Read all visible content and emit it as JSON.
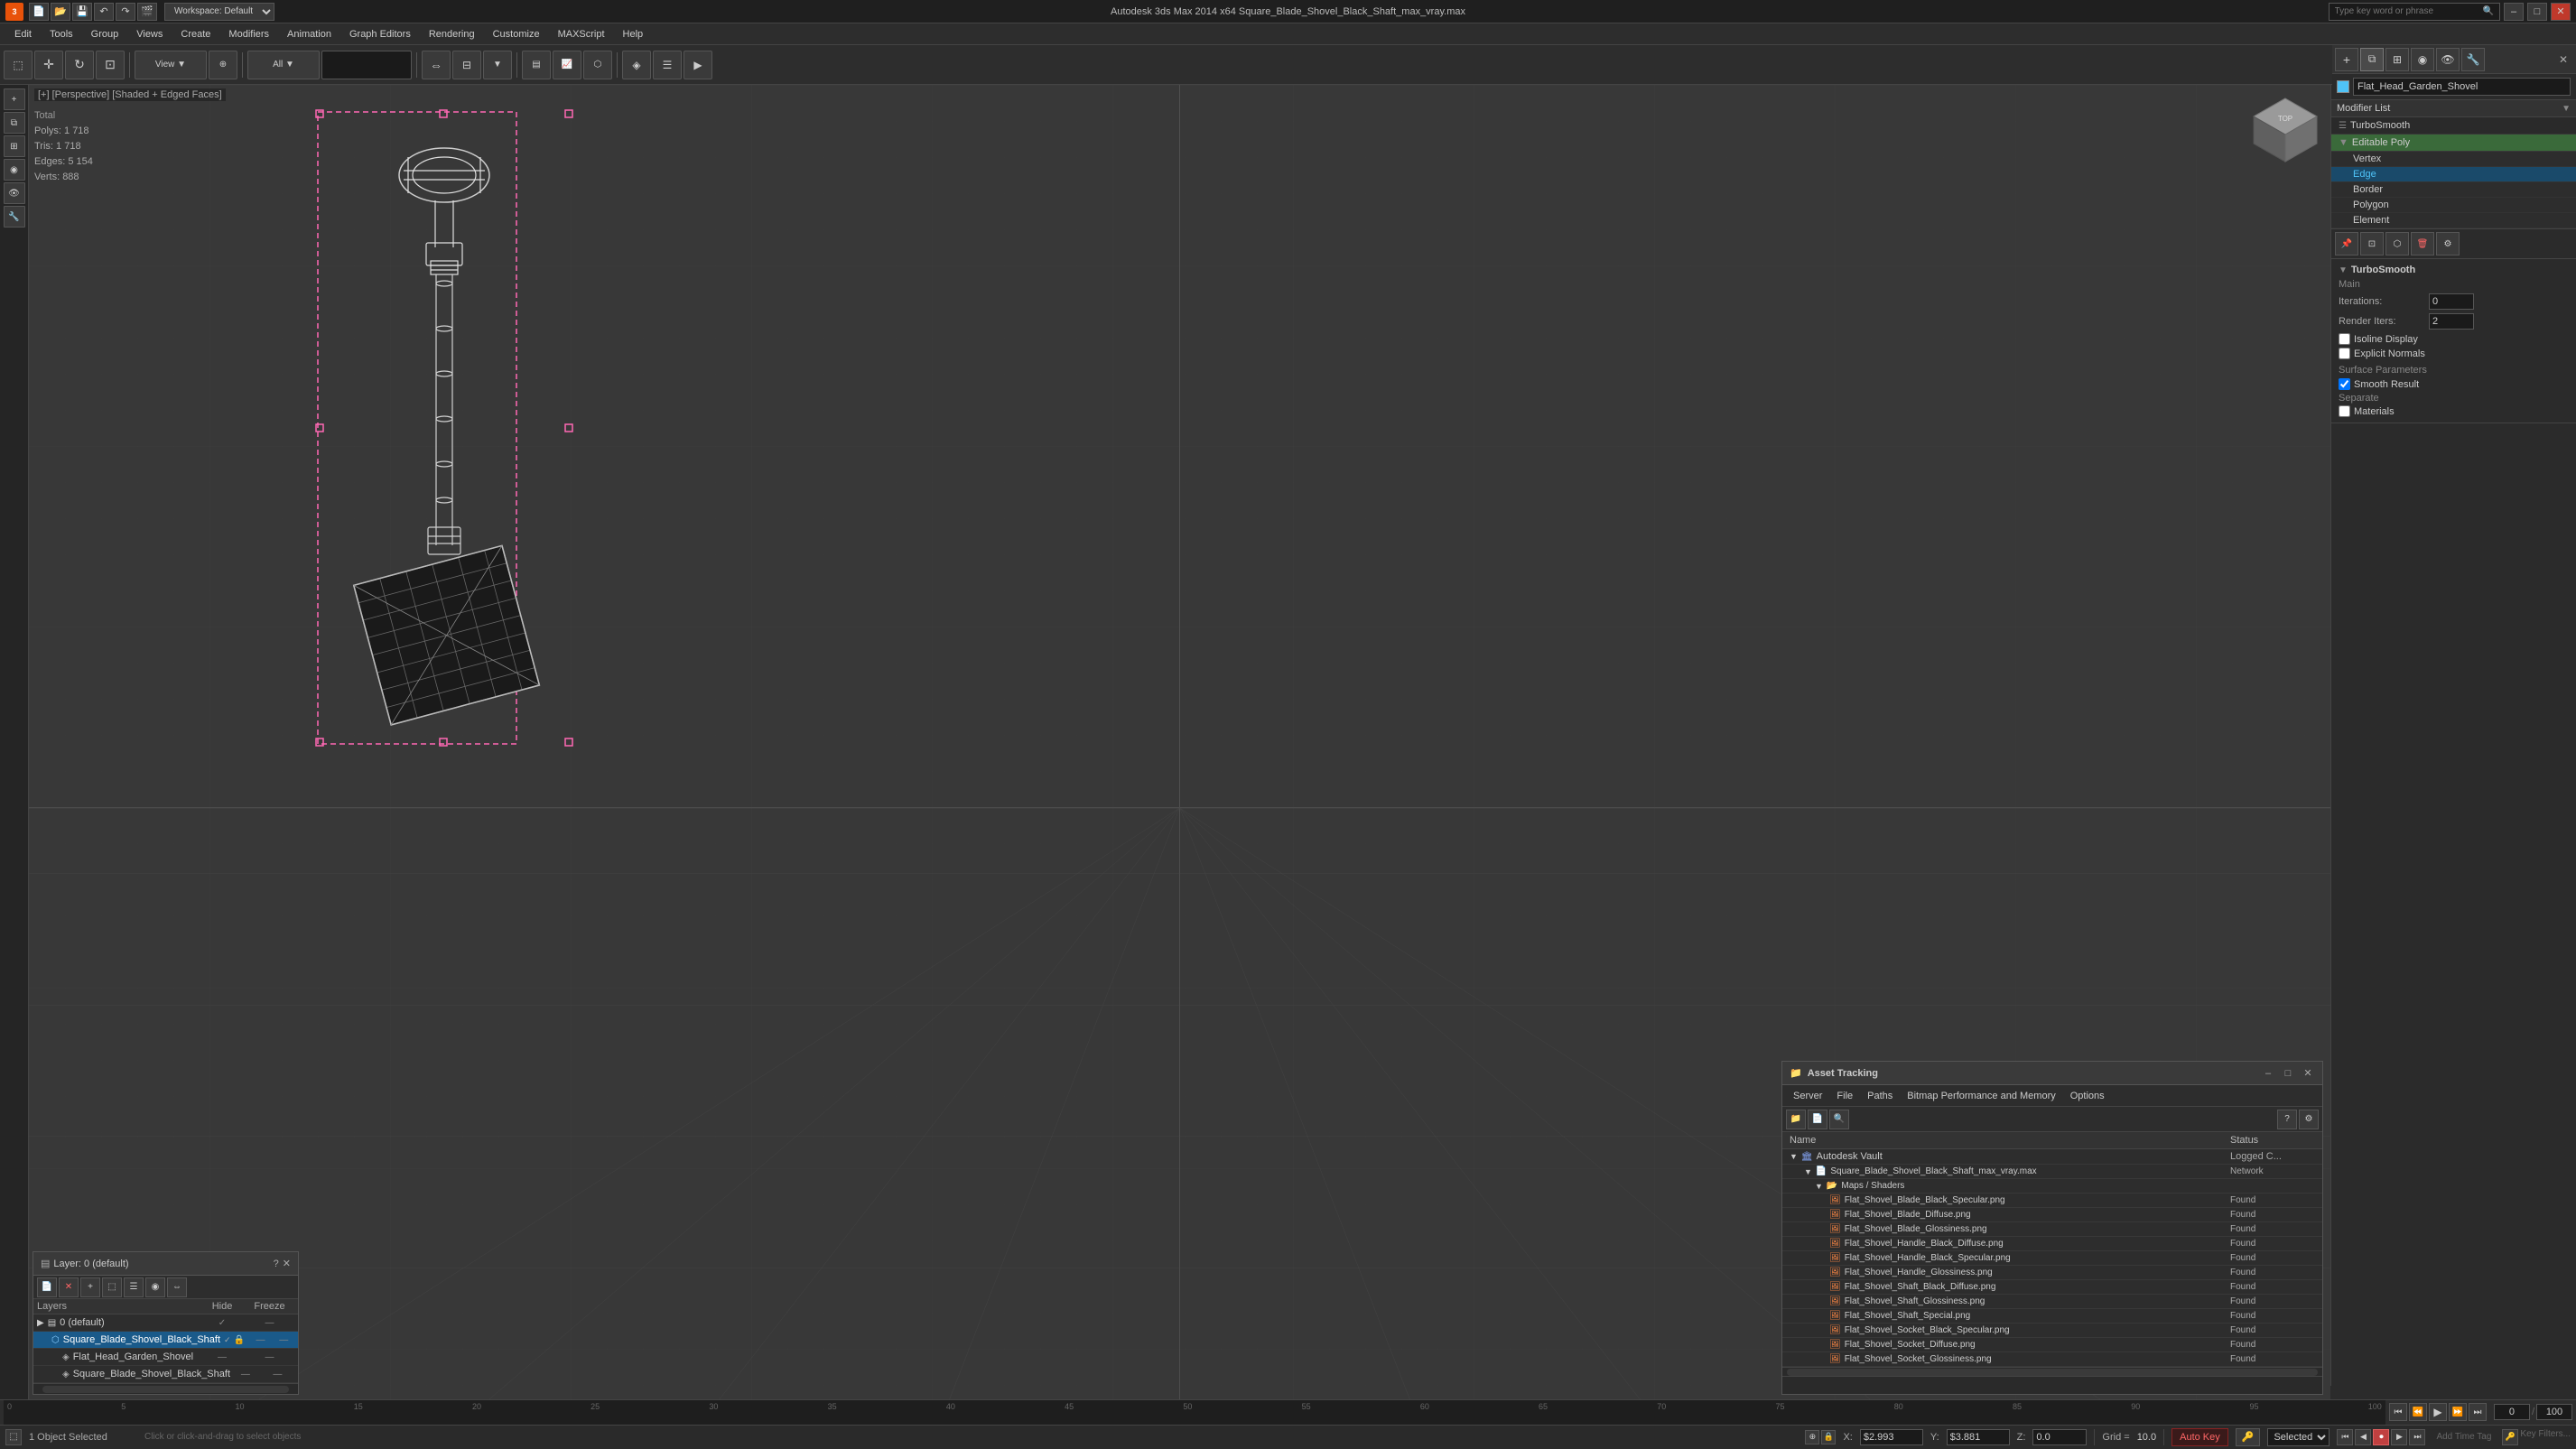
{
  "titlebar": {
    "title": "Autodesk 3ds Max 2014 x64    Square_Blade_Shovel_Black_Shaft_max_vray.max",
    "minimize": "–",
    "maximize": "□",
    "close": "✕"
  },
  "menubar": {
    "items": [
      "Edit",
      "Tools",
      "Group",
      "Views",
      "Create",
      "Modifiers",
      "Animation",
      "Graph Editors",
      "Rendering",
      "Customize",
      "MAXScript",
      "Help"
    ]
  },
  "search": {
    "placeholder": "Type key word or phrase"
  },
  "viewport": {
    "label": "[+] [Perspective] [Shaded + Edged Faces]"
  },
  "stats": {
    "polys_label": "Polys:",
    "polys_val": "1 718",
    "tris_label": "Tris:",
    "tris_val": "1 718",
    "edges_label": "Edges:",
    "edges_val": "5 154",
    "verts_label": "Verts:",
    "verts_val": "888"
  },
  "right_panel": {
    "object_name": "Flat_Head_Garden_Shovel",
    "modifier_list": "Modifier List",
    "modifiers": [
      "TurboSmooth",
      "Editable Poly"
    ],
    "edpoly_items": [
      "Vertex",
      "Edge",
      "Border",
      "Polygon",
      "Element"
    ],
    "active_sub": "Edge",
    "turbosmooth": {
      "label": "TurboSmooth",
      "main": "Main",
      "iterations_label": "Iterations:",
      "iterations_val": "0",
      "render_iters_label": "Render Iters:",
      "render_iters_val": "2",
      "isoline": "Isoline Display",
      "explicit": "Explicit Normals",
      "surface_params": "Surface Parameters",
      "smooth_result": "Smooth Result",
      "separate": "Separate",
      "materials": "Materials"
    }
  },
  "asset_tracking": {
    "title": "Asset Tracking",
    "menu": [
      "Server",
      "File",
      "Paths",
      "Bitmap Performance and Memory",
      "Options"
    ],
    "columns": {
      "name": "Name",
      "status": "Status"
    },
    "rows": [
      {
        "indent": 1,
        "icon": "vault",
        "name": "Autodesk Vault",
        "status": "Logged C..."
      },
      {
        "indent": 2,
        "icon": "file",
        "name": "Square_Blade_Shovel_Black_Shaft_max_vray.max",
        "status": "Network"
      },
      {
        "indent": 3,
        "icon": "folder",
        "name": "Maps / Shaders",
        "status": ""
      },
      {
        "indent": 4,
        "icon": "img",
        "name": "Flat_Shovel_Blade_Black_Specular.png",
        "status": "Found"
      },
      {
        "indent": 4,
        "icon": "img",
        "name": "Flat_Shovel_Blade_Diffuse.png",
        "status": "Found"
      },
      {
        "indent": 4,
        "icon": "img",
        "name": "Flat_Shovel_Blade_Glossiness.png",
        "status": "Found"
      },
      {
        "indent": 4,
        "icon": "img",
        "name": "Flat_Shovel_Handle_Black_Diffuse.png",
        "status": "Found"
      },
      {
        "indent": 4,
        "icon": "img",
        "name": "Flat_Shovel_Handle_Black_Specular.png",
        "status": "Found"
      },
      {
        "indent": 4,
        "icon": "img",
        "name": "Flat_Shovel_Handle_Glossiness.png",
        "status": "Found"
      },
      {
        "indent": 4,
        "icon": "img",
        "name": "Flat_Shovel_Shaft_Black_Diffuse.png",
        "status": "Found"
      },
      {
        "indent": 4,
        "icon": "img",
        "name": "Flat_Shovel_Shaft_Glossiness.png",
        "status": "Found"
      },
      {
        "indent": 4,
        "icon": "img",
        "name": "Flat_Shovel_Shaft_Special.png",
        "status": "Found"
      },
      {
        "indent": 4,
        "icon": "img",
        "name": "Flat_Shovel_Socket_Black_Specular.png",
        "status": "Found"
      },
      {
        "indent": 4,
        "icon": "img",
        "name": "Flat_Shovel_Socket_Diffuse.png",
        "status": "Found"
      },
      {
        "indent": 4,
        "icon": "img",
        "name": "Flat_Shovel_Socket_Glossiness.png",
        "status": "Found"
      }
    ]
  },
  "layers": {
    "title": "Layer: 0 (default)",
    "columns": {
      "name": "Layers",
      "hide": "Hide",
      "freeze": "Freeze"
    },
    "rows": [
      {
        "indent": 0,
        "name": "0 (default)",
        "hide": "✓",
        "freeze": "",
        "selected": false
      },
      {
        "indent": 1,
        "name": "Square_Blade_Shovel_Black_Shaft",
        "hide": "",
        "freeze": "",
        "selected": true
      },
      {
        "indent": 2,
        "name": "Flat_Head_Garden_Shovel",
        "hide": "",
        "freeze": "",
        "selected": false
      },
      {
        "indent": 2,
        "name": "Square_Blade_Shovel_Black_Shaft",
        "hide": "",
        "freeze": "",
        "selected": false
      }
    ]
  },
  "statusbar": {
    "selected_text": "1 Object Selected",
    "hint_text": "Click or click-and-drag to select objects",
    "x_label": "X:",
    "x_val": "$2.993",
    "y_label": "Y:",
    "y_val": "$3.881",
    "z_label": "Z:",
    "z_val": "0.0",
    "grid_label": "Grid =",
    "grid_val": "10.0",
    "auto_key": "Auto Key",
    "selected_dropdown": "Selected",
    "add_time_tag": "Add Time Tag"
  },
  "timeline": {
    "start": "0",
    "end": "100",
    "current": "0",
    "markers": [
      "0",
      "5",
      "10",
      "15",
      "20",
      "25",
      "30",
      "35",
      "40",
      "45",
      "50",
      "55",
      "60",
      "65",
      "70",
      "75",
      "80",
      "85",
      "90",
      "95",
      "100"
    ]
  }
}
